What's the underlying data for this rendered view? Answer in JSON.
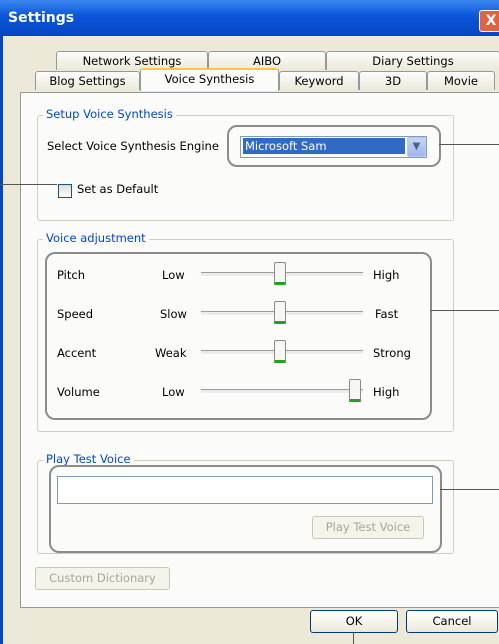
{
  "window": {
    "title": "Settings",
    "close_label": "X"
  },
  "tabs": {
    "row1": [
      "Network Settings",
      "AIBO",
      "Diary Settings"
    ],
    "row2": [
      "Blog Settings",
      "Voice Synthesis",
      "Keyword",
      "3D",
      "Movie"
    ],
    "selected": "Voice Synthesis"
  },
  "setup": {
    "legend": "Setup Voice Synthesis",
    "engine_label": "Select Voice Synthesis Engine",
    "engine_value": "Microsoft Sam",
    "default_checkbox_label": "Set as Default",
    "default_checked": false
  },
  "voice_adjustment": {
    "legend": "Voice adjustment",
    "sliders": [
      {
        "name": "Pitch",
        "low": "Low",
        "high": "High",
        "level": 0.5
      },
      {
        "name": "Speed",
        "low": "Slow",
        "high": "Fast",
        "level": 0.5
      },
      {
        "name": "Accent",
        "low": "Weak",
        "high": "Strong",
        "level": 0.5
      },
      {
        "name": "Volume",
        "low": "Low",
        "high": "High",
        "level": 1.0
      }
    ]
  },
  "play_test": {
    "legend": "Play Test Voice",
    "input_value": "",
    "button_label": "Play Test Voice"
  },
  "custom_dictionary_label": "Custom Dictionary",
  "ok_label": "OK",
  "cancel_label": "Cancel"
}
